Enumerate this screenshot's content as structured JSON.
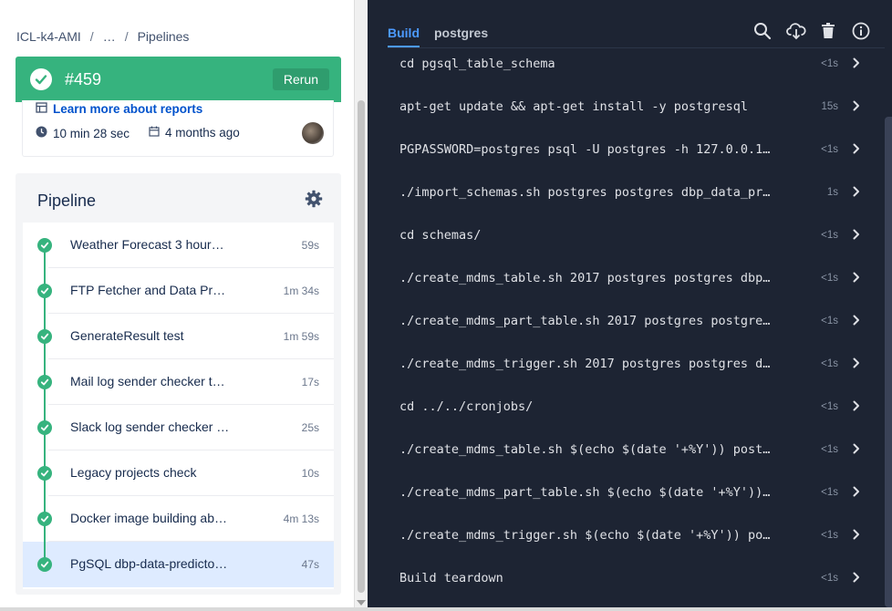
{
  "breadcrumb": {
    "repo": "ICL-k4-AMI",
    "ellipsis": "…",
    "current": "Pipelines",
    "sep": "/"
  },
  "status": {
    "number": "#459",
    "rerun_label": "Rerun",
    "color": "#36b37e"
  },
  "info": {
    "learn_more": "Learn more about reports",
    "duration": "10 min 28 sec",
    "time_ago": "4 months ago"
  },
  "pipeline": {
    "title": "Pipeline",
    "steps": [
      {
        "name": "Weather Forecast 3 hour…",
        "duration": "59s"
      },
      {
        "name": "FTP Fetcher and Data Pr…",
        "duration": "1m 34s"
      },
      {
        "name": "GenerateResult test",
        "duration": "1m 59s"
      },
      {
        "name": "Mail log sender checker t…",
        "duration": "17s"
      },
      {
        "name": "Slack log sender checker …",
        "duration": "25s"
      },
      {
        "name": "Legacy projects check",
        "duration": "10s"
      },
      {
        "name": "Docker image building ab…",
        "duration": "4m 13s"
      },
      {
        "name": "PgSQL dbp-data-predicto…",
        "duration": "47s"
      }
    ]
  },
  "log": {
    "tabs": [
      {
        "label": "Build"
      },
      {
        "label": "postgres"
      }
    ],
    "rows": [
      {
        "cmd": "cd pgsql_table_schema",
        "time": "<1s"
      },
      {
        "cmd": "apt-get update && apt-get install -y postgresql",
        "time": "15s"
      },
      {
        "cmd": "PGPASSWORD=postgres psql -U postgres -h 127.0.0.1…",
        "time": "<1s"
      },
      {
        "cmd": "./import_schemas.sh postgres postgres dbp_data_pr…",
        "time": "1s"
      },
      {
        "cmd": "cd schemas/",
        "time": "<1s"
      },
      {
        "cmd": "./create_mdms_table.sh 2017 postgres postgres dbp…",
        "time": "<1s"
      },
      {
        "cmd": "./create_mdms_part_table.sh 2017 postgres postgre…",
        "time": "<1s"
      },
      {
        "cmd": "./create_mdms_trigger.sh 2017 postgres postgres d…",
        "time": "<1s"
      },
      {
        "cmd": "cd ../../cronjobs/",
        "time": "<1s"
      },
      {
        "cmd": "./create_mdms_table.sh $(echo $(date '+%Y')) post…",
        "time": "<1s"
      },
      {
        "cmd": "./create_mdms_part_table.sh $(echo $(date '+%Y'))…",
        "time": "<1s"
      },
      {
        "cmd": "./create_mdms_trigger.sh $(echo $(date '+%Y')) po…",
        "time": "<1s"
      },
      {
        "cmd": "Build teardown",
        "time": "<1s"
      }
    ]
  },
  "icons": {
    "toolbar": [
      "search-icon",
      "download-icon",
      "trash-icon",
      "info-icon"
    ]
  }
}
